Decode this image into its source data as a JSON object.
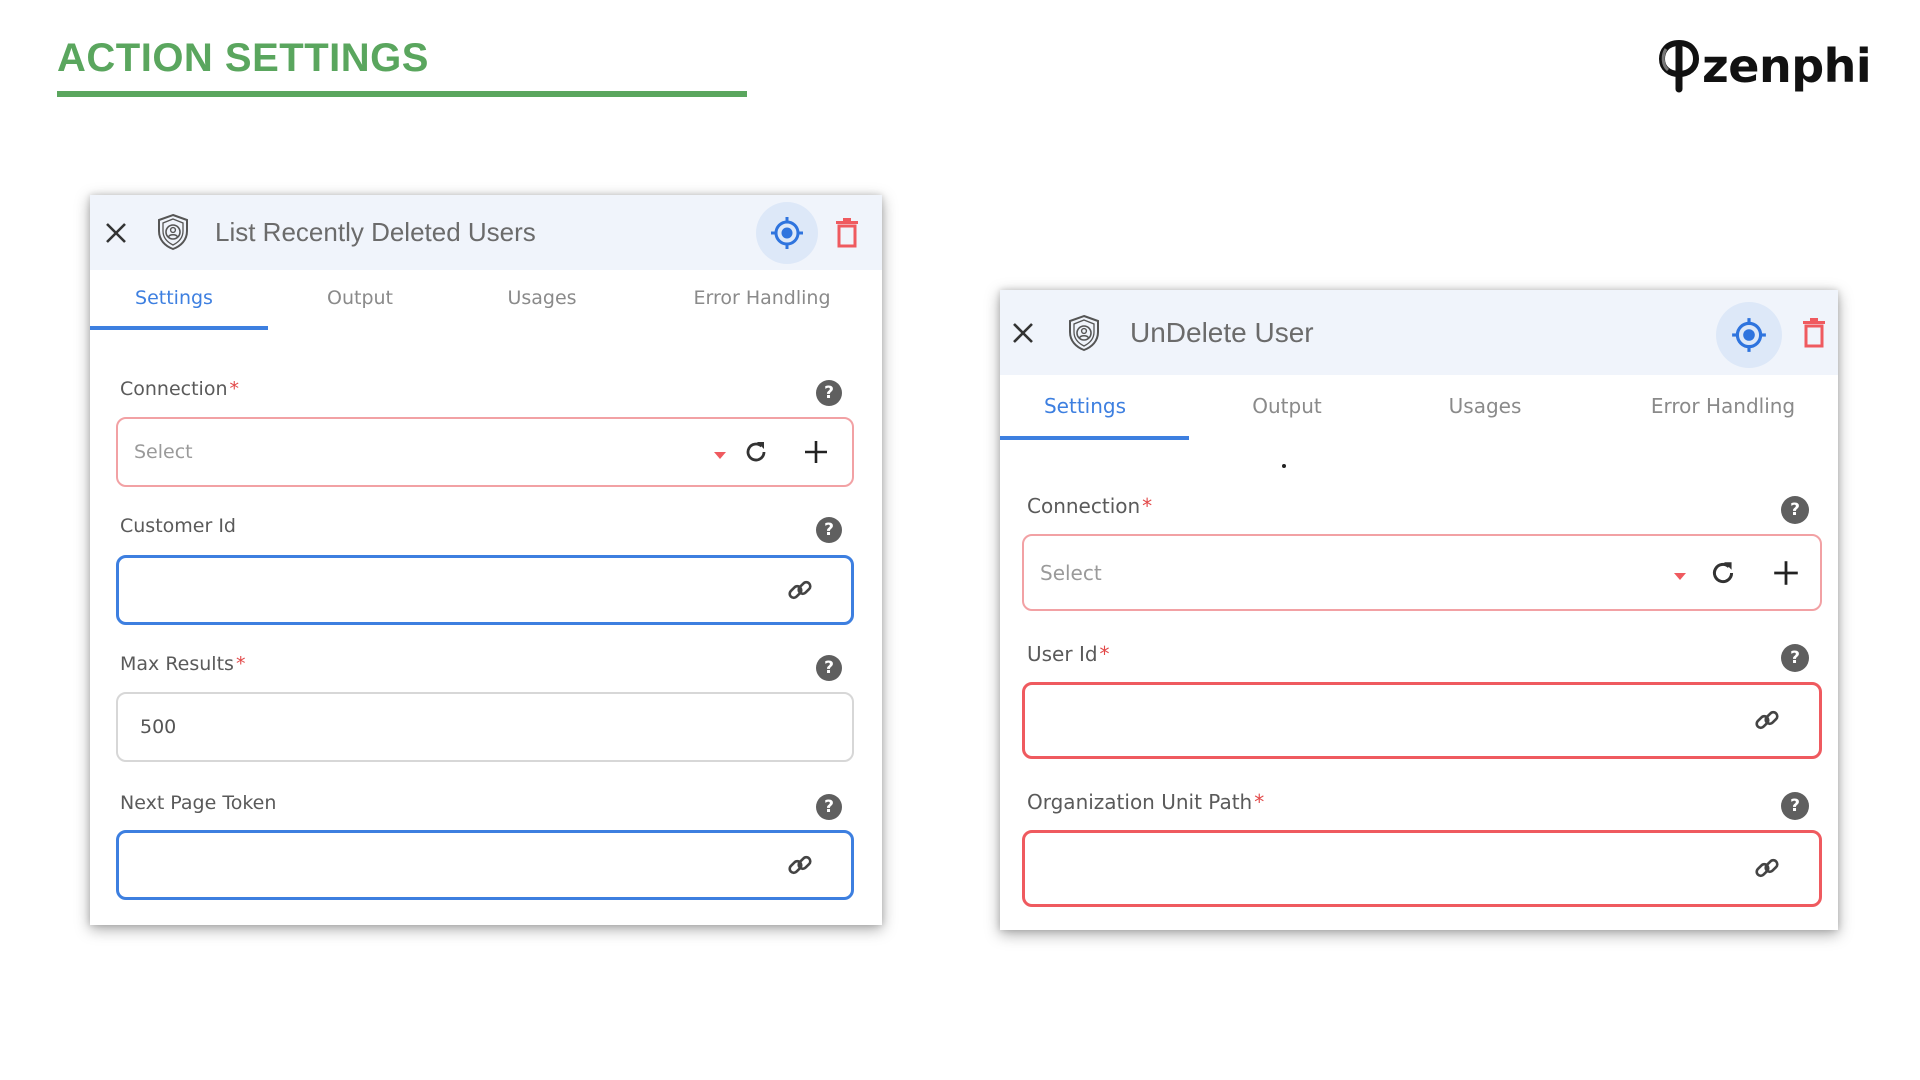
{
  "page": {
    "title": "ACTION SETTINGS",
    "brand": "zenphi",
    "accent_color": "#5aa65e"
  },
  "colors": {
    "tab_active": "#3d7fe0",
    "required": "#e24848",
    "error_border": "#ef5a5f",
    "focus_border": "#3d7fe0",
    "header_bg": "#f0f4fb",
    "delete_icon": "#ef5a5f"
  },
  "panels": [
    {
      "title": "List Recently Deleted Users",
      "icons": {
        "close": "close-icon",
        "type": "shield-user-icon",
        "locate": "target-icon",
        "delete": "trash-icon"
      },
      "tabs": [
        {
          "label": "Settings",
          "active": true
        },
        {
          "label": "Output",
          "active": false
        },
        {
          "label": "Usages",
          "active": false
        },
        {
          "label": "Error Handling",
          "active": false
        }
      ],
      "fields": [
        {
          "label": "Connection",
          "required": true,
          "type": "select",
          "value": "",
          "placeholder": "Select",
          "help": "?"
        },
        {
          "label": "Customer Id",
          "required": false,
          "type": "text",
          "value": "",
          "state": "focused",
          "help": "?"
        },
        {
          "label": "Max Results",
          "required": true,
          "type": "text",
          "value": "500",
          "help": "?"
        },
        {
          "label": "Next Page Token",
          "required": false,
          "type": "text",
          "value": "",
          "state": "focused",
          "help": "?"
        }
      ]
    },
    {
      "title": "UnDelete User",
      "icons": {
        "close": "close-icon",
        "type": "shield-user-icon",
        "locate": "target-icon",
        "delete": "trash-icon"
      },
      "tabs": [
        {
          "label": "Settings",
          "active": true
        },
        {
          "label": "Output",
          "active": false
        },
        {
          "label": "Usages",
          "active": false
        },
        {
          "label": "Error Handling",
          "active": false
        }
      ],
      "fields": [
        {
          "label": "Connection",
          "required": true,
          "type": "select",
          "value": "",
          "placeholder": "Select",
          "help": "?"
        },
        {
          "label": "User Id",
          "required": true,
          "type": "text",
          "value": "",
          "state": "error",
          "help": "?"
        },
        {
          "label": "Organization Unit Path",
          "required": true,
          "type": "text",
          "value": "",
          "state": "error",
          "help": "?"
        }
      ]
    }
  ],
  "required_marker": "*"
}
